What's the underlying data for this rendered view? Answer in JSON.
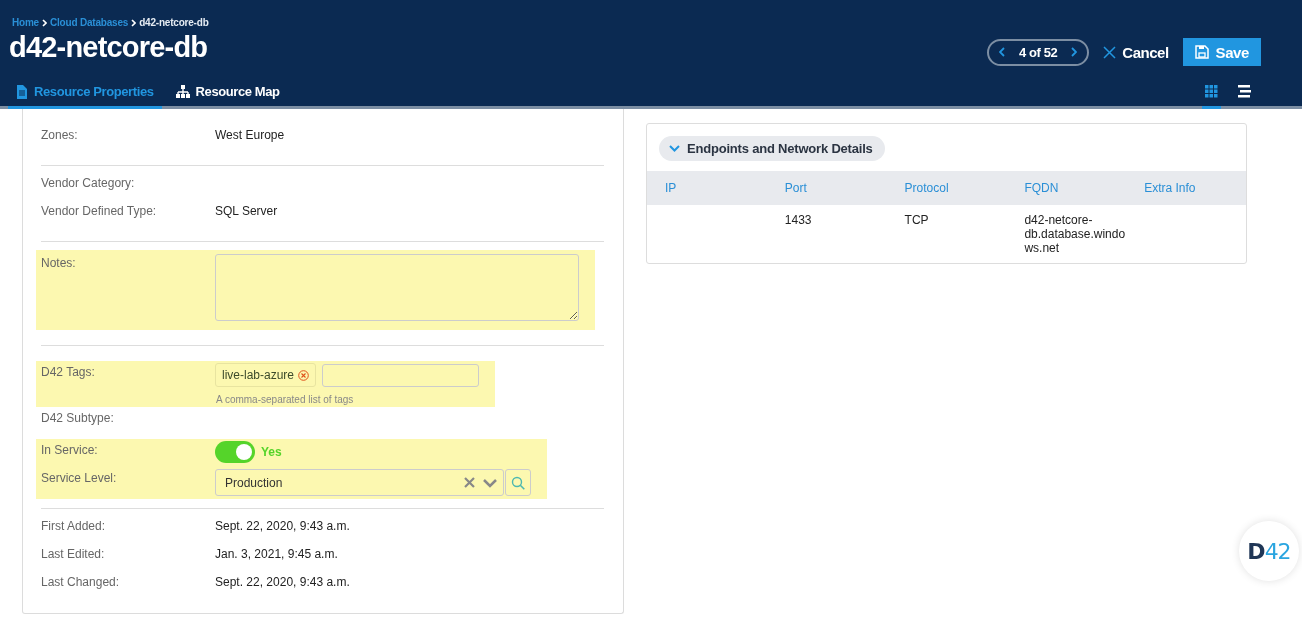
{
  "breadcrumb": [
    {
      "label": "Home",
      "kind": "link"
    },
    {
      "label": "Cloud Databases",
      "kind": "link"
    },
    {
      "label": "d42-netcore-db",
      "kind": "current"
    }
  ],
  "title": "d42-netcore-db",
  "pager": {
    "label": "4 of 52"
  },
  "cancel_button": "Cancel",
  "save_button": "Save",
  "tabs": [
    {
      "label": "Resource Properties",
      "selected": true
    },
    {
      "label": "Resource Map",
      "selected": false
    }
  ],
  "view_modes": [
    {
      "kind": "grid",
      "selected": true
    },
    {
      "kind": "list",
      "selected": false
    }
  ],
  "sections": [
    {
      "blocks": [
        {
          "highlighted": false,
          "rows": [
            {
              "kind": "text",
              "label": "Zones:",
              "value": "West Europe"
            }
          ]
        }
      ]
    },
    {
      "blocks": [
        {
          "highlighted": false,
          "rows": [
            {
              "kind": "text",
              "label": "Vendor Category:"
            },
            {
              "kind": "text",
              "label": "Vendor Defined Type:",
              "value": "SQL Server"
            }
          ]
        }
      ]
    },
    {
      "blocks": [
        {
          "highlighted": true,
          "rows": [
            {
              "kind": "textarea",
              "label": "Notes:"
            }
          ]
        }
      ]
    },
    {
      "blocks": [
        {
          "highlighted": true,
          "rows": [
            {
              "kind": "tags",
              "label": "D42 Tags:",
              "tags": [
                "live-lab-azure"
              ],
              "help": "A comma-separated list of tags"
            }
          ]
        },
        {
          "highlighted": false,
          "rows": [
            {
              "kind": "text",
              "label": "D42 Subtype:"
            }
          ]
        },
        {
          "highlighted": true,
          "rows": [
            {
              "kind": "toggle",
              "label": "In Service:",
              "on": true,
              "value": "Yes"
            },
            {
              "kind": "select",
              "label": "Service Level:",
              "value": "Production"
            }
          ]
        }
      ]
    },
    {
      "blocks": [
        {
          "highlighted": false,
          "rows": [
            {
              "kind": "text",
              "label": "First Added:",
              "value": "Sept. 22, 2020, 9:43 a.m."
            },
            {
              "kind": "text",
              "label": "Last Edited:",
              "value": "Jan. 3, 2021, 9:45 a.m."
            },
            {
              "kind": "text",
              "label": "Last Changed:",
              "value": "Sept. 22, 2020, 9:43 a.m."
            }
          ]
        }
      ]
    }
  ],
  "endpoints": {
    "title": "Endpoints and Network Details",
    "columns": [
      "IP",
      "Port",
      "Protocol",
      "FQDN",
      "Extra Info"
    ],
    "rows": [
      [
        "",
        "1433",
        "TCP",
        "d42-netcore-db.database.windows.net",
        ""
      ]
    ]
  },
  "logo": {
    "prefix": "D",
    "suffix": "42"
  }
}
